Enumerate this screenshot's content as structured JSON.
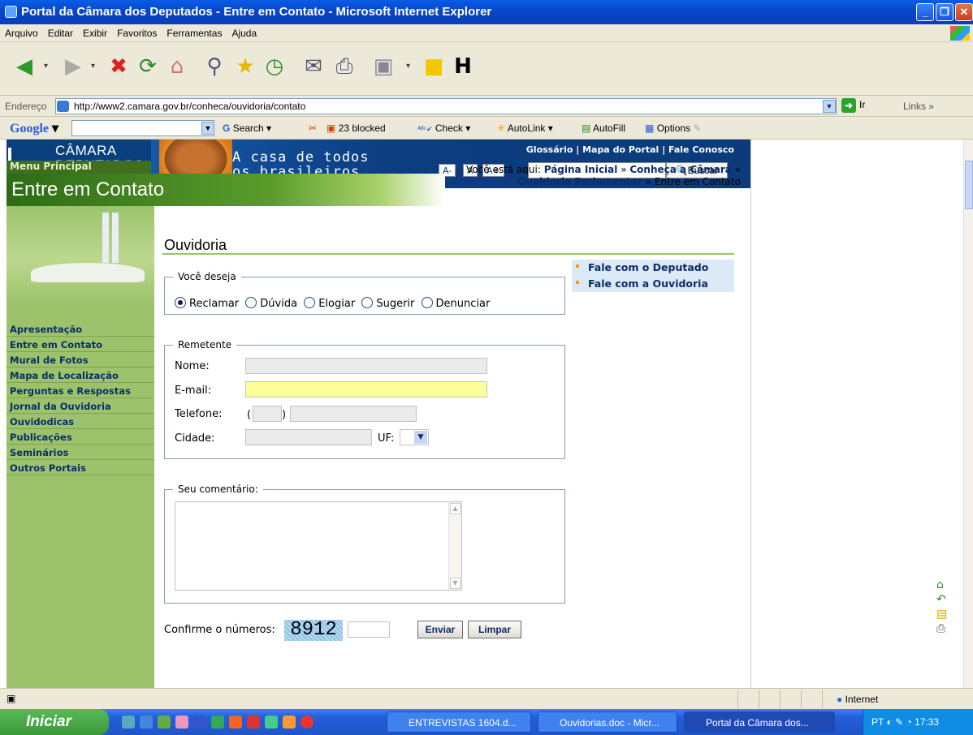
{
  "window": {
    "title": "Portal da Câmara dos Deputados - Entre em Contato - Microsoft Internet Explorer"
  },
  "menu": [
    "Arquivo",
    "Editar",
    "Exibir",
    "Favoritos",
    "Ferramentas",
    "Ajuda"
  ],
  "address": {
    "label": "Endereço",
    "url": "http://www2.camara.gov.br/conheca/ouvidoria/contato",
    "go": "Ir",
    "links": "Links"
  },
  "googlebar": {
    "logo": "Google",
    "search": "Search",
    "blocked": "23 blocked",
    "check": "Check",
    "autolink": "AutoLink",
    "autofill": "AutoFill",
    "options": "Options"
  },
  "header": {
    "logo_line1": "CÂMARA DOS",
    "logo_line2": "DEPUTADOS",
    "slogan1": "A casa de todos",
    "slogan2": "os brasileiros.",
    "toplinks": "Glossário | Mapa do Portal | Fale Conosco",
    "font_small": "A-",
    "font_normal": "A",
    "font_large": "A+",
    "search_button": "Buscar",
    "menu_header": "Menu Principal",
    "section_title": "Entre em Contato",
    "breadcrumb_prefix": "Você está aqui: ",
    "breadcrumb_1": "Página Inicial",
    "breadcrumb_2": "Conheça a Câmara",
    "breadcrumb_3": "Ouvidoria Parlamentar",
    "breadcrumb_4": "Entre em Contato"
  },
  "nav": [
    "Apresentação",
    "Entre em Contato",
    "Mural de Fotos",
    "Mapa de Localização",
    "Perguntas e Respostas",
    "Jornal da Ouvidoria",
    "Ouvidodicas",
    "Publicações",
    "Seminários",
    "Outros Portais"
  ],
  "content": {
    "title": "Ouvidoria",
    "side_links": [
      "Fale com o Deputado",
      "Fale com a Ouvidoria"
    ],
    "wish_legend": "Você deseja",
    "wish_options": [
      "Reclamar",
      "Dúvida",
      "Elogiar",
      "Sugerir",
      "Denunciar"
    ],
    "wish_selected": "Reclamar",
    "sender_legend": "Remetente",
    "name_label": "Nome:",
    "email_label": "E-mail:",
    "phone_label": "Telefone:",
    "phone_open": "(",
    "phone_close": ")",
    "city_label": "Cidade:",
    "uf_label": "UF:",
    "comment_legend": "Seu comentário:",
    "confirm_label": "Confirme o números:",
    "captcha": "8912",
    "send_button": "Enviar",
    "clear_button": "Limpar"
  },
  "status": {
    "zone": "Internet"
  },
  "taskbar": {
    "start": "Iniciar",
    "tasks": [
      "ENTREVISTAS 1604.d...",
      "Ouvidorias.doc - Micr...",
      "Portal da Câmara dos..."
    ],
    "lang": "PT",
    "clock": "17:33"
  }
}
